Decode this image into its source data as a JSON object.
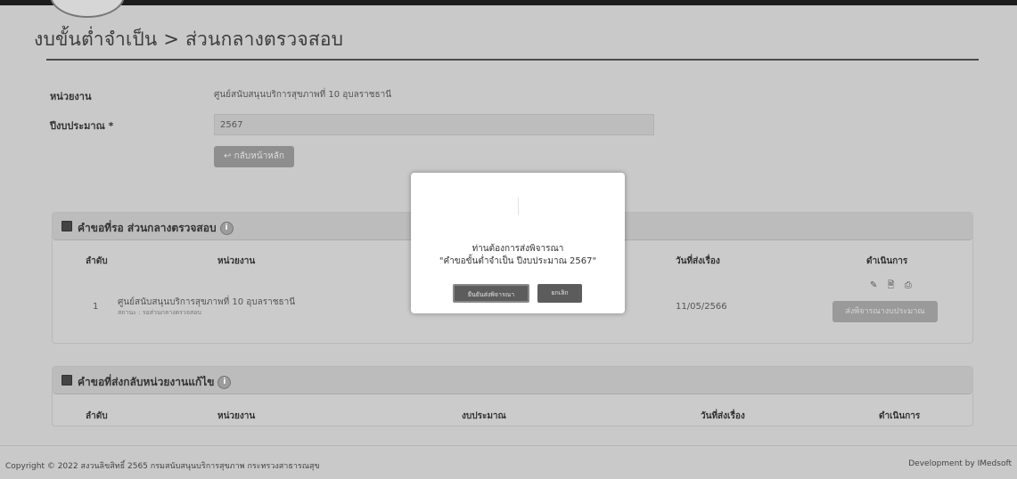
{
  "header": {
    "title": "งบขั้นต่ำจำเป็น > ส่วนกลางตรวจสอบ"
  },
  "form": {
    "unit_label": "หน่วยงาน",
    "unit_value": "ศูนย์สนับสนุนบริการสุขภาพที่ 10 อุบลราชธานี",
    "year_label": "ปีงบประมาณ *",
    "year_value": "2567",
    "back_button": "↩ กลับหน้าหลัก"
  },
  "panel_pending": {
    "title": "คำขอที่รอ ส่วนกลางตรวจสอบ",
    "columns": {
      "no": "ลำดับ",
      "unit": "หน่วยงาน",
      "date": "วันที่ส่งเรื่อง",
      "action": "ดำเนินการ"
    },
    "rows": [
      {
        "no": "1",
        "unit": "ศูนย์สนับสนุนบริการสุขภาพที่ 10 อุบลราชธานี",
        "status": "สถานะ : รอส่วนกลางตรวจสอบ",
        "date": "11/05/2566",
        "action_icons": "✎ 🗎 ⎙",
        "action_button": "ส่งพิจารณางบประมาณ"
      }
    ]
  },
  "panel_returned": {
    "title": "คำขอที่ส่งกลับหน่วยงานแก้ไข",
    "columns": {
      "no": "ลำดับ",
      "unit": "หน่วยงาน",
      "budget": "งบประมาณ",
      "date": "วันที่ส่งเรื่อง",
      "action": "ดำเนินการ"
    }
  },
  "footer": {
    "copyright": "Copyright © 2022 สงวนลิขสิทธิ์ 2565 กรมสนับสนุนบริการสุขภาพ กระทรวงสาธารณสุข",
    "developer": "Development by IMedsoft"
  },
  "modal": {
    "line1": "ท่านต้องการส่งพิจารณา",
    "line2": "\"คำขอขั้นต่ำจำเป็น ปีงบประมาณ 2567\"",
    "confirm": "ยืนยันส่งพิจารณา",
    "cancel": "ยกเลิก"
  },
  "icons": {
    "info": "i"
  }
}
